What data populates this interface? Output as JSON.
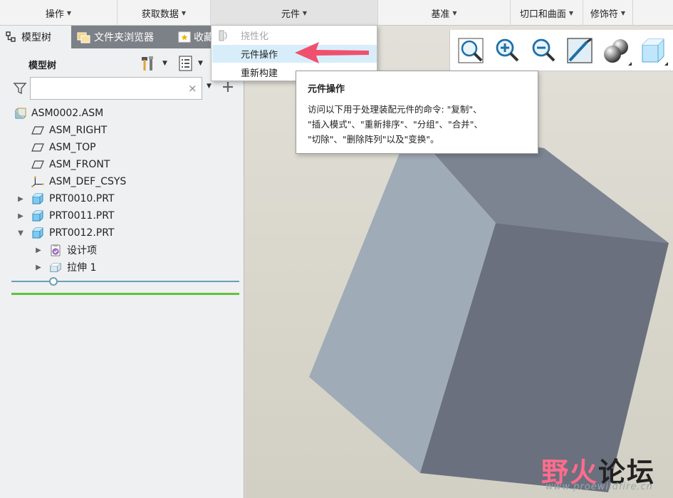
{
  "ribbon": {
    "groups": [
      {
        "label": "操作"
      },
      {
        "label": "获取数据"
      },
      {
        "label": "元件"
      },
      {
        "label": "基准"
      },
      {
        "label": "切口和曲面"
      },
      {
        "label": "修饰符"
      }
    ]
  },
  "left_panel": {
    "tabs": [
      {
        "label": "模型树"
      },
      {
        "label": "文件夹浏览器"
      },
      {
        "label": "收藏"
      }
    ],
    "tree_title": "模型树",
    "filter": {
      "value": "",
      "clear_symbol": "×"
    },
    "tree": [
      {
        "label": "ASM0002.ASM",
        "icon": "assembly-icon"
      },
      {
        "label": "ASM_RIGHT",
        "icon": "datum-plane-icon"
      },
      {
        "label": "ASM_TOP",
        "icon": "datum-plane-icon"
      },
      {
        "label": "ASM_FRONT",
        "icon": "datum-plane-icon"
      },
      {
        "label": "ASM_DEF_CSYS",
        "icon": "csys-icon"
      },
      {
        "label": "PRT0010.PRT",
        "icon": "part-icon"
      },
      {
        "label": "PRT0011.PRT",
        "icon": "part-icon"
      },
      {
        "label": "PRT0012.PRT",
        "icon": "part-icon"
      },
      {
        "label": "设计项",
        "icon": "design-items-icon"
      },
      {
        "label": "拉伸 1",
        "icon": "extrude-icon"
      }
    ]
  },
  "dropdown": {
    "items": [
      {
        "label": "挠性化",
        "state": "disabled"
      },
      {
        "label": "元件操作",
        "state": "hover"
      },
      {
        "label": "重新构建",
        "state": "normal"
      }
    ]
  },
  "tooltip": {
    "title": "元件操作",
    "lines": [
      "访问以下用于处理装配元件的命令: \"复制\"、",
      "\"插入模式\"、\"重新排序\"、\"分组\"、\"合并\"、",
      "\"切除\"、\"删除阵列\"以及\"变换\"。"
    ]
  },
  "watermark": {
    "part1": "野火",
    "part2": "论坛",
    "url": "www.proewildfire.cn"
  },
  "colors": {
    "accent_hover": "#d7eefa",
    "annotation_arrow": "#f0506e",
    "tab_bar": "#7c8087",
    "cube_light": "#a0abb8",
    "cube_dark": "#6a707e"
  }
}
